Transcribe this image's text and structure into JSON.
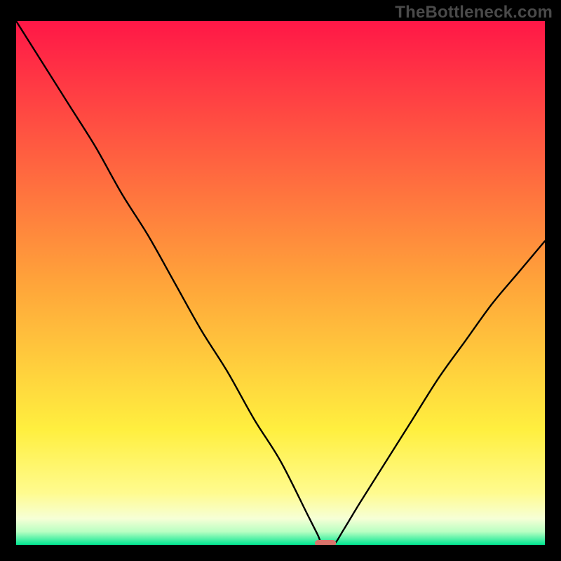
{
  "watermark": "TheBottleneck.com",
  "colors": {
    "frame": "#000000",
    "watermark": "#4a4a4a",
    "curve": "#000000",
    "marker_fill": "#d9736b",
    "gradient_top": "#ff1747",
    "gradient_50": "#ffa43a",
    "gradient_78": "#ffef3f",
    "gradient_90": "#fffb8e",
    "gradient_95": "#f6ffd6",
    "gradient_97": "#b8ffc2",
    "gradient_bottom": "#00e691"
  },
  "chart_data": {
    "type": "line",
    "title": "",
    "xlabel": "",
    "ylabel": "",
    "xlim": [
      0,
      100
    ],
    "ylim": [
      0,
      100
    ],
    "x": [
      0,
      5,
      10,
      15,
      20,
      25,
      30,
      35,
      40,
      45,
      50,
      55,
      57,
      58,
      60,
      62,
      65,
      70,
      75,
      80,
      85,
      90,
      95,
      100
    ],
    "values": [
      100,
      92,
      84,
      76,
      67,
      59,
      50,
      41,
      33,
      24,
      16,
      6,
      2,
      0,
      0,
      3,
      8,
      16,
      24,
      32,
      39,
      46,
      52,
      58
    ],
    "marker": {
      "x": 58.5,
      "y": 0,
      "width": 4,
      "height": 1.2
    },
    "annotations": []
  }
}
